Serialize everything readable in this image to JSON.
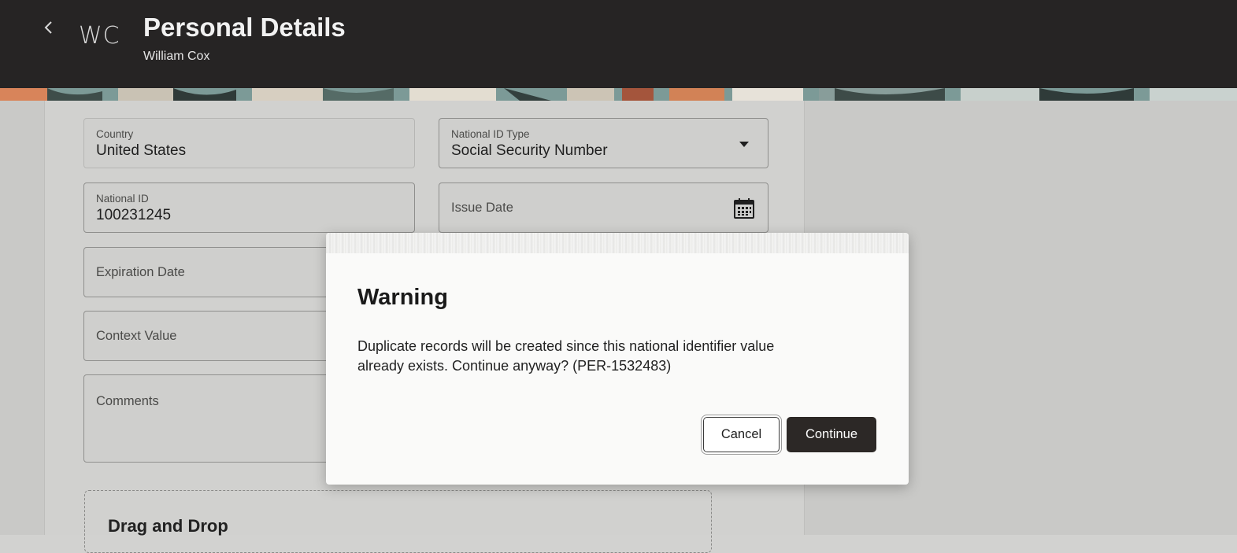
{
  "header": {
    "back_icon": "chevron-left-icon",
    "avatar_initials": "WC",
    "title": "Personal Details",
    "subtitle": "William Cox"
  },
  "form": {
    "country": {
      "label": "Country",
      "value": "United States"
    },
    "national_id_type": {
      "label": "National ID Type",
      "value": "Social Security Number",
      "icon": "dropdown-caret-icon"
    },
    "national_id": {
      "label": "National ID",
      "value": "100231245"
    },
    "issue_date": {
      "label": "Issue Date",
      "icon": "calendar-icon"
    },
    "expiration_date": {
      "label": "Expiration Date"
    },
    "context_value": {
      "label": "Context Value"
    },
    "comments": {
      "label": "Comments"
    },
    "dropzone": {
      "title": "Drag and Drop"
    }
  },
  "dialog": {
    "title": "Warning",
    "message_line1": "Duplicate records will be created since this national identifier value",
    "message_line2": "already exists. Continue anyway? (PER-1532483)",
    "cancel_label": "Cancel",
    "continue_label": "Continue"
  },
  "colors": {
    "header_bg": "#262424",
    "primary_button": "#2c2826",
    "overlay_bg": "#d1d1cf"
  }
}
